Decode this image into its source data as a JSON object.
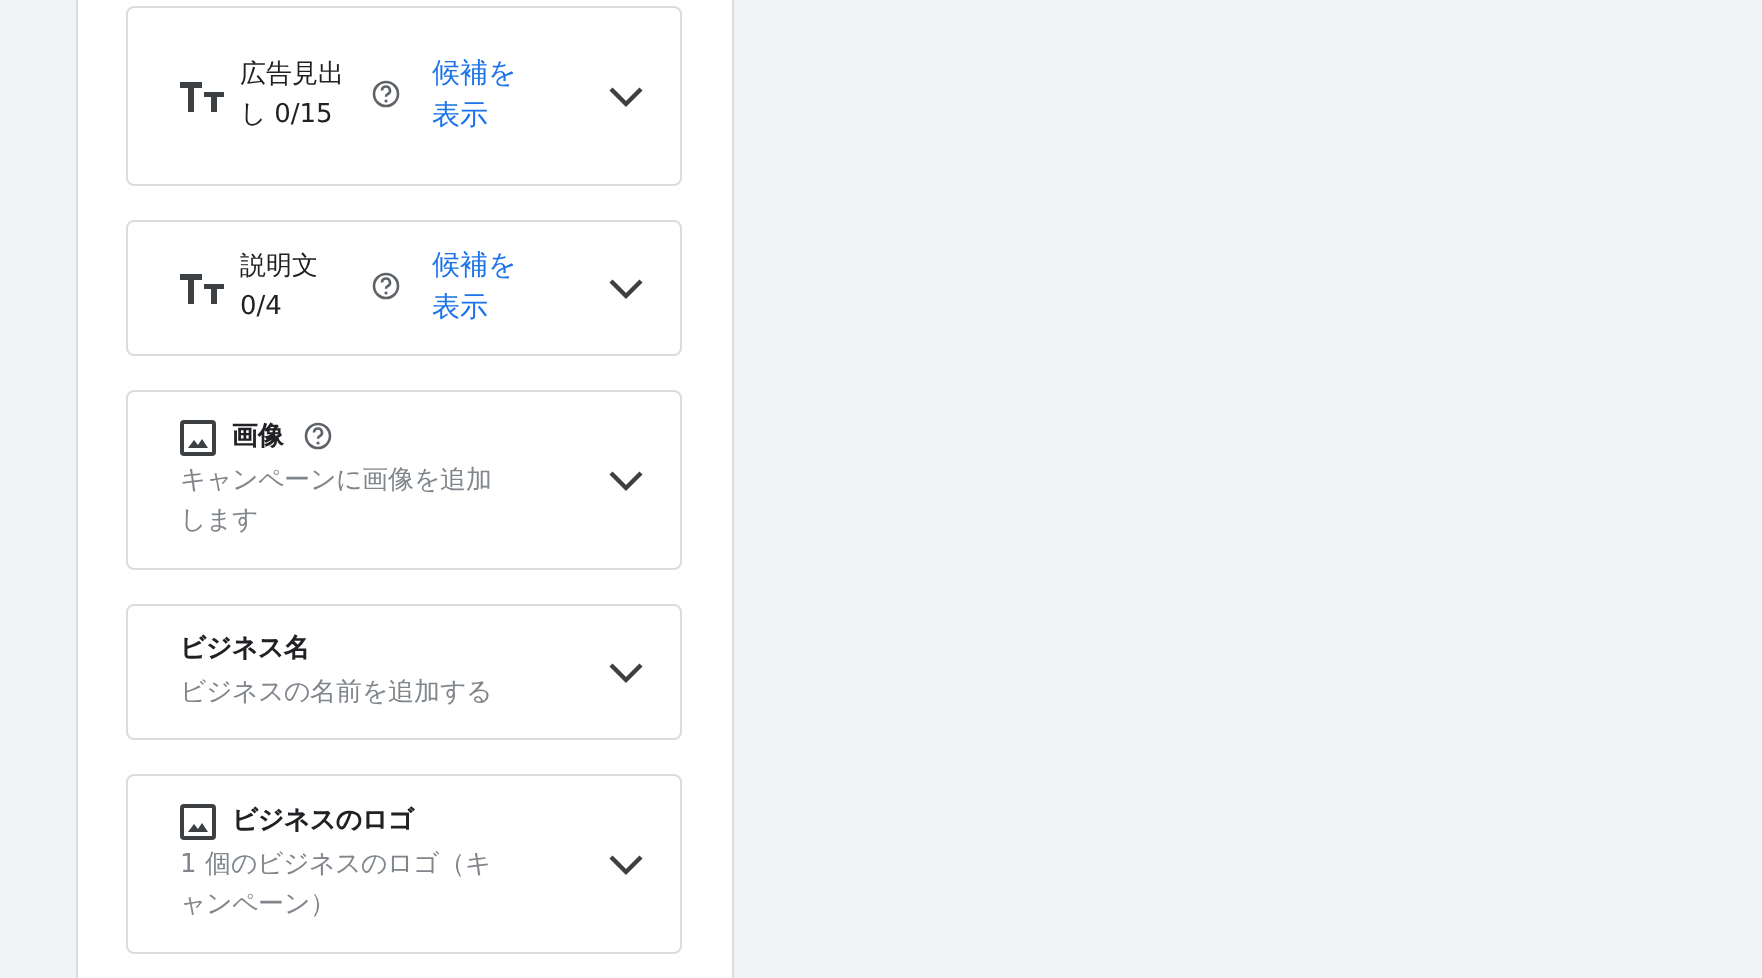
{
  "cards": [
    {
      "kind": "text",
      "title": "広告見出し 0/15",
      "help": true,
      "link": "候補を表示"
    },
    {
      "kind": "text",
      "title": "説明文 0/4",
      "help": true,
      "link": "候補を表示"
    },
    {
      "kind": "image",
      "title": "画像",
      "help": true,
      "subtitle": "キャンペーンに画像を追加します"
    },
    {
      "kind": "plain",
      "title": "ビジネス名",
      "help": false,
      "subtitle": "ビジネスの名前を追加する"
    },
    {
      "kind": "image",
      "title": "ビジネスのロゴ",
      "help": false,
      "subtitle": "1 個のビジネスのロゴ（キャンペーン）"
    }
  ]
}
